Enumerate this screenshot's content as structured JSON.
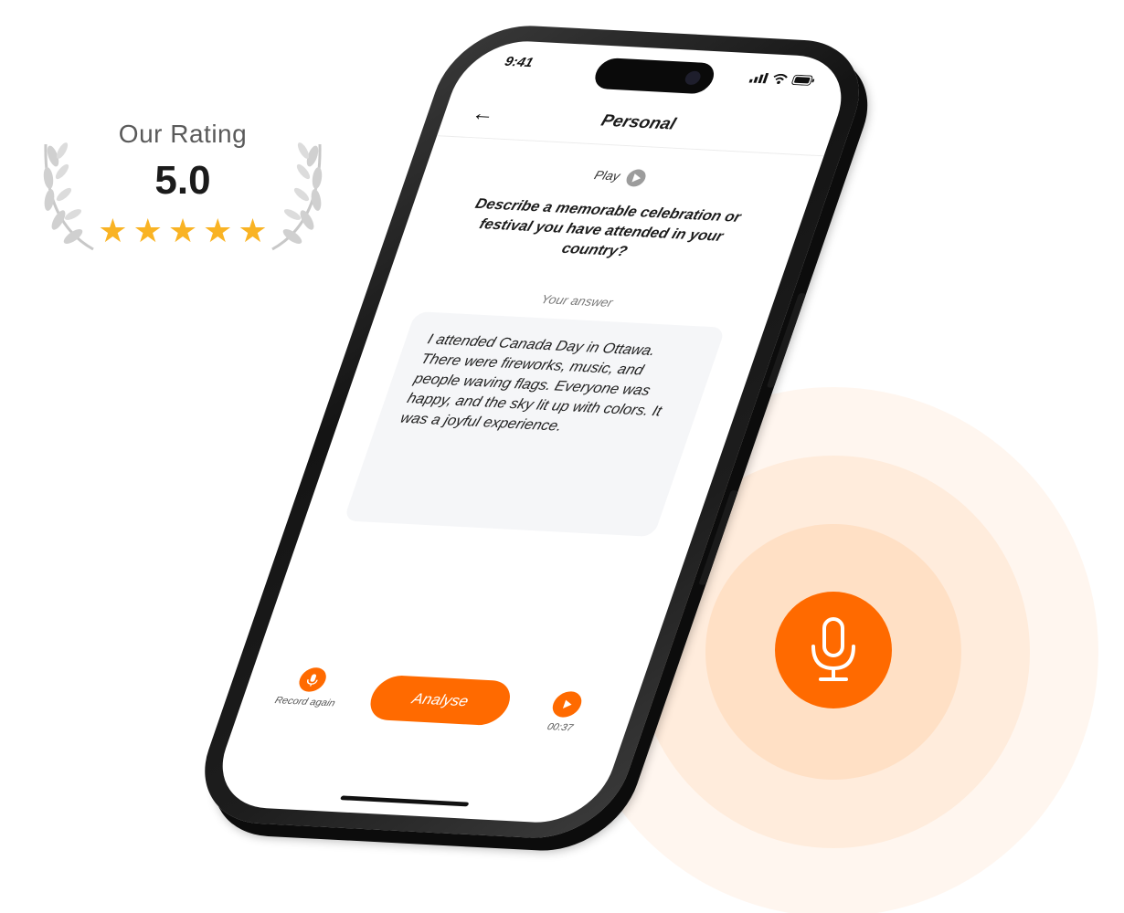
{
  "rating": {
    "title": "Our Rating",
    "score": "5.0",
    "stars": 5,
    "star_color": "#f9b324",
    "laurel_icon": "laurel-wreath-icon"
  },
  "status_bar": {
    "time": "9:41",
    "icons": [
      "signal-icon",
      "wifi-icon",
      "battery-icon"
    ]
  },
  "header": {
    "back_icon": "arrow-left-icon",
    "title": "Personal"
  },
  "prompt": {
    "play_label": "Play",
    "question": "Describe a memorable celebration or festival you have attended in your country?"
  },
  "answer": {
    "label": "Your answer",
    "text": "I attended Canada Day in Ottawa. There were fireworks, music, and people waving flags. Everyone was happy, and the sky lit up with colors. It was a joyful experience."
  },
  "actions": {
    "record_again_label": "Record again",
    "analyse_label": "Analyse",
    "duration": "00:37"
  },
  "mic": {
    "icon": "microphone-icon",
    "accent": "#ff6a00"
  }
}
